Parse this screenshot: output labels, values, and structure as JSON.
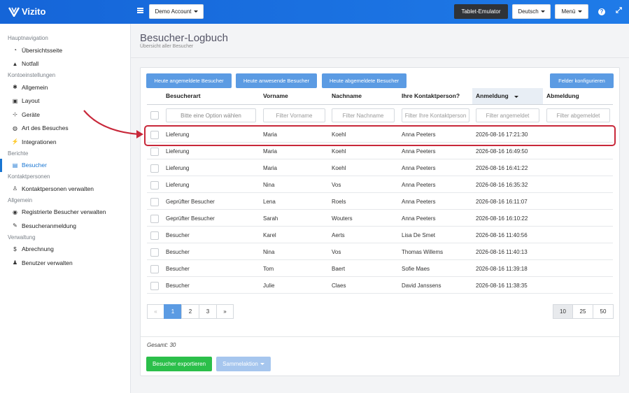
{
  "app": {
    "brand": "Vizito",
    "account_button": "Demo Account",
    "tablet_button": "Tablet-Emulator",
    "language_button": "Deutsch",
    "menu_button": "Menü",
    "help_icon": "question-icon",
    "expand_icon": "expand-icon"
  },
  "sidebar": {
    "sections": [
      {
        "title": "Hauptnavigation",
        "items": [
          {
            "label": "Übersichtsseite",
            "icon": "dashboard-icon",
            "glyph": "◔"
          },
          {
            "label": "Notfall",
            "icon": "warning-icon",
            "glyph": "▲"
          }
        ]
      },
      {
        "title": "Kontoeinstellungen",
        "items": [
          {
            "label": "Allgemein",
            "icon": "gear-icon",
            "glyph": "✱"
          },
          {
            "label": "Layout",
            "icon": "image-icon",
            "glyph": "▣"
          },
          {
            "label": "Geräte",
            "icon": "sitemap-icon",
            "glyph": "⊹"
          },
          {
            "label": "Art des Besuches",
            "icon": "users-icon",
            "glyph": "◍"
          },
          {
            "label": "Integrationen",
            "icon": "plug-icon",
            "glyph": "⚡"
          }
        ]
      },
      {
        "title": "Berichte",
        "items": [
          {
            "label": "Besucher",
            "icon": "book-icon",
            "glyph": "▤",
            "active": true
          }
        ]
      },
      {
        "title": "Kontaktpersonen",
        "items": [
          {
            "label": "Kontaktpersonen verwalten",
            "icon": "user-tie-icon",
            "glyph": "♙"
          }
        ]
      },
      {
        "title": "Allgemein",
        "items": [
          {
            "label": "Registrierte Besucher verwalten",
            "icon": "user-circle-icon",
            "glyph": "◉"
          },
          {
            "label": "Besucheranmeldung",
            "icon": "pencil-icon",
            "glyph": "✎"
          }
        ]
      },
      {
        "title": "Verwaltung",
        "items": [
          {
            "label": "Abrechnung",
            "icon": "dollar-icon",
            "glyph": "$"
          },
          {
            "label": "Benutzer verwalten",
            "icon": "user-plus-icon",
            "glyph": "♟"
          }
        ]
      }
    ]
  },
  "page": {
    "title": "Besucher-Logbuch",
    "subtitle": "Übersicht aller Besucher"
  },
  "toolbar": {
    "today_registered": "Heute angemeldete Besucher",
    "today_present": "Heute anwesende Besucher",
    "today_deregistered": "Heute abgemeldete Besucher",
    "configure_fields": "Felder konfigurieren"
  },
  "table": {
    "columns": [
      "Besucherart",
      "Vorname",
      "Nachname",
      "Ihre Kontaktperson?",
      "Anmeldung",
      "Abmeldung"
    ],
    "filters": [
      "Bitte eine Option wählen",
      "Filter Vorname",
      "Filter Nachname",
      "Filter Ihre Kontaktperson",
      "Filter angemeldet",
      "Filter abgemeldet"
    ],
    "rows": [
      [
        "Lieferung",
        "Maria",
        "Koehl",
        "Anna Peeters",
        "2026-08-16 17:21:30",
        ""
      ],
      [
        "Lieferung",
        "Maria",
        "Koehl",
        "Anna Peeters",
        "2026-08-16 16:49:50",
        ""
      ],
      [
        "Lieferung",
        "Maria",
        "Koehl",
        "Anna Peeters",
        "2026-08-16 16:41:22",
        ""
      ],
      [
        "Lieferung",
        "Nina",
        "Vos",
        "Anna Peeters",
        "2026-08-16 16:35:32",
        ""
      ],
      [
        "Geprüfter Besucher",
        "Lena",
        "Roels",
        "Anna Peeters",
        "2026-08-16 16:11:07",
        ""
      ],
      [
        "Geprüfter Besucher",
        "Sarah",
        "Wouters",
        "Anna Peeters",
        "2026-08-16 16:10:22",
        ""
      ],
      [
        "Besucher",
        "Karel",
        "Aerts",
        "Lisa De Smet",
        "2026-08-16 11:40:56",
        ""
      ],
      [
        "Besucher",
        "Nina",
        "Vos",
        "Thomas Willems",
        "2026-08-16 11:40:13",
        ""
      ],
      [
        "Besucher",
        "Tom",
        "Baert",
        "Sofie Maes",
        "2026-08-16 11:39:18",
        ""
      ],
      [
        "Besucher",
        "Julie",
        "Claes",
        "David Janssens",
        "2026-08-16 11:38:35",
        ""
      ]
    ],
    "sorted_column": "Anmeldung",
    "sort_direction": "descending"
  },
  "pagination": {
    "prev": "«",
    "pages": [
      "1",
      "2",
      "3"
    ],
    "next": "»",
    "current": "1",
    "page_sizes": [
      "10",
      "25",
      "50"
    ],
    "current_size": "10"
  },
  "footer": {
    "total": "Gesamt: 30",
    "export_button": "Besucher exportieren",
    "bulk_action_button": "Sammelaktion"
  },
  "annotation": {
    "highlight_color": "#c8283a",
    "highlighted_row": 0
  }
}
